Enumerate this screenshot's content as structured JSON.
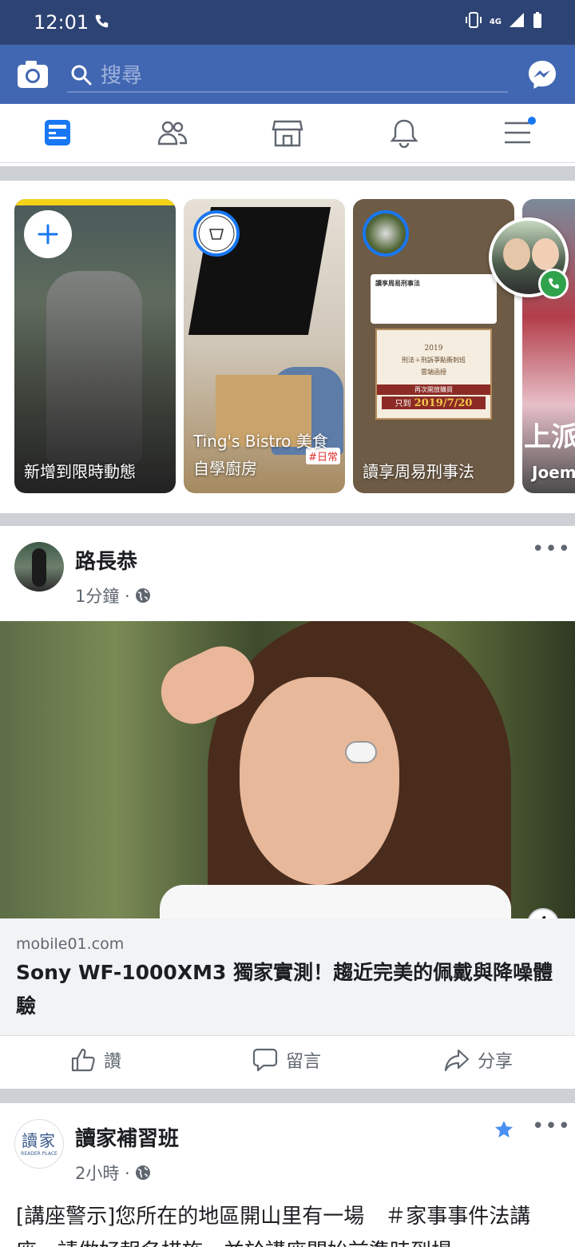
{
  "status_bar": {
    "time": "12:01",
    "network": "4G"
  },
  "app_bar": {
    "search_placeholder": "搜尋"
  },
  "stories": [
    {
      "label": "新增到限時動態"
    },
    {
      "label": "Ting's Bistro 美食\n自學廚房",
      "tag": "#日常",
      "line1": "Ting's Bistro 美食",
      "line2": "自學廚房"
    },
    {
      "label": "讀享周易刑事法",
      "card_title": "讀享周易刑事法",
      "card_year": "2019",
      "card_sub": "刑法＋刑訴爭點衝刺班",
      "card_mode": "雲端函授",
      "card_note": "再次開放購買",
      "card_date_prefix": "只到",
      "card_date": "2019/7/20"
    },
    {
      "label": "Joem",
      "overlay": "上派"
    }
  ],
  "post1": {
    "author": "路長恭",
    "time": "1分鐘 ·",
    "link_source": "mobile01.com",
    "link_title": "Sony WF-1000XM3 獨家實測！趨近完美的佩戴與降噪體驗",
    "actions": {
      "like": "讚",
      "comment": "留言",
      "share": "分享"
    }
  },
  "post2": {
    "author": "讀家補習班",
    "avatar_text": "讀家",
    "avatar_sub": "READER PLACE",
    "time": "2小時 ·",
    "text": "[講座警示]您所在的地區開山里有一場　＃家事事件法講座，請做好報名措施，並於講座開始前準時到場。"
  },
  "colors": {
    "brand": "#4267b2",
    "status": "#2d4373",
    "accent": "#1877f2",
    "call": "#31a24c"
  }
}
